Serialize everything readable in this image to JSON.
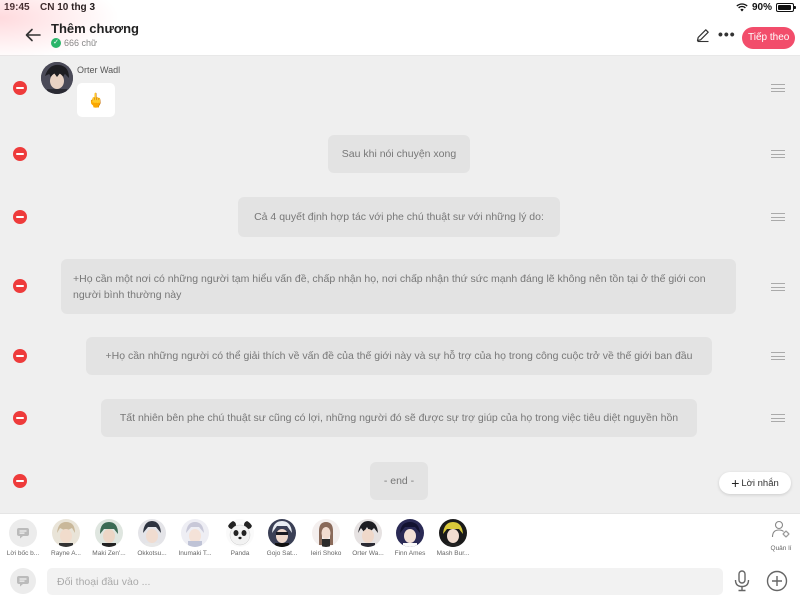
{
  "status_bar": {
    "time": "19:45",
    "date": "CN 10 thg 3",
    "battery": "90%",
    "battery_level": 0.9
  },
  "header": {
    "title": "Thêm chương",
    "word_count": "666 chữ",
    "next_label": "Tiếp theo",
    "back_icon": "arrow-left-icon",
    "edit_icon": "pencil-icon",
    "more_icon": "more-horizontal-icon"
  },
  "messages": [
    {
      "type": "character",
      "sender": "Orter Wadl",
      "text": "🖕"
    },
    {
      "type": "narration",
      "text": "Sau khi nói chuyện xong"
    },
    {
      "type": "narration",
      "text": "Cả 4 quyết định hợp tác với phe chú thuật sư với những lý do:"
    },
    {
      "type": "narration",
      "text": "+Họ cần một nơi có những người tạm hiểu vấn đề, chấp nhận họ, nơi chấp nhận thứ sức mạnh đáng lẽ không nên tồn tại ở thế giới con người bình thường này"
    },
    {
      "type": "narration",
      "text": "+Họ cần những người có thể giải thích về vấn đề của thế giới này và sự hỗ trợ của họ trong công cuộc trở về thế giới ban đầu"
    },
    {
      "type": "narration",
      "text": "Tất nhiên bên phe chú thuật sư cũng có lợi, những người đó sẽ được sự trợ giúp của họ trong việc tiêu diệt nguyền hồn"
    },
    {
      "type": "narration",
      "text": "- end -"
    }
  ],
  "add_message_label": "Lời nhắn",
  "characters": [
    {
      "name": "Lời bốc b...",
      "color": "#d0d0d0"
    },
    {
      "name": "Rayne A...",
      "color": "#c9b89a"
    },
    {
      "name": "Maki Zen'...",
      "color": "#3c6b55"
    },
    {
      "name": "Okkotsu...",
      "color": "#2d3340"
    },
    {
      "name": "Inumaki T...",
      "color": "#c8c8d8"
    },
    {
      "name": "Panda",
      "color": "#222222"
    },
    {
      "name": "Gojo Sat...",
      "color": "#3a3f55"
    },
    {
      "name": "Ieiri Shoko",
      "color": "#8a6a5a"
    },
    {
      "name": "Orter Wa...",
      "color": "#3a3a48"
    },
    {
      "name": "Finn Ames",
      "color": "#2a2a55"
    },
    {
      "name": "Mash Bur...",
      "color": "#d9c93a"
    }
  ],
  "manage_label": "Quản lí",
  "input": {
    "placeholder": "Đối thoại đầu vào ..."
  },
  "colors": {
    "accent": "#f24d6b",
    "delete": "#ee3b3b",
    "chat_bg": "#efefef",
    "bubble": "#e3e3e3"
  }
}
